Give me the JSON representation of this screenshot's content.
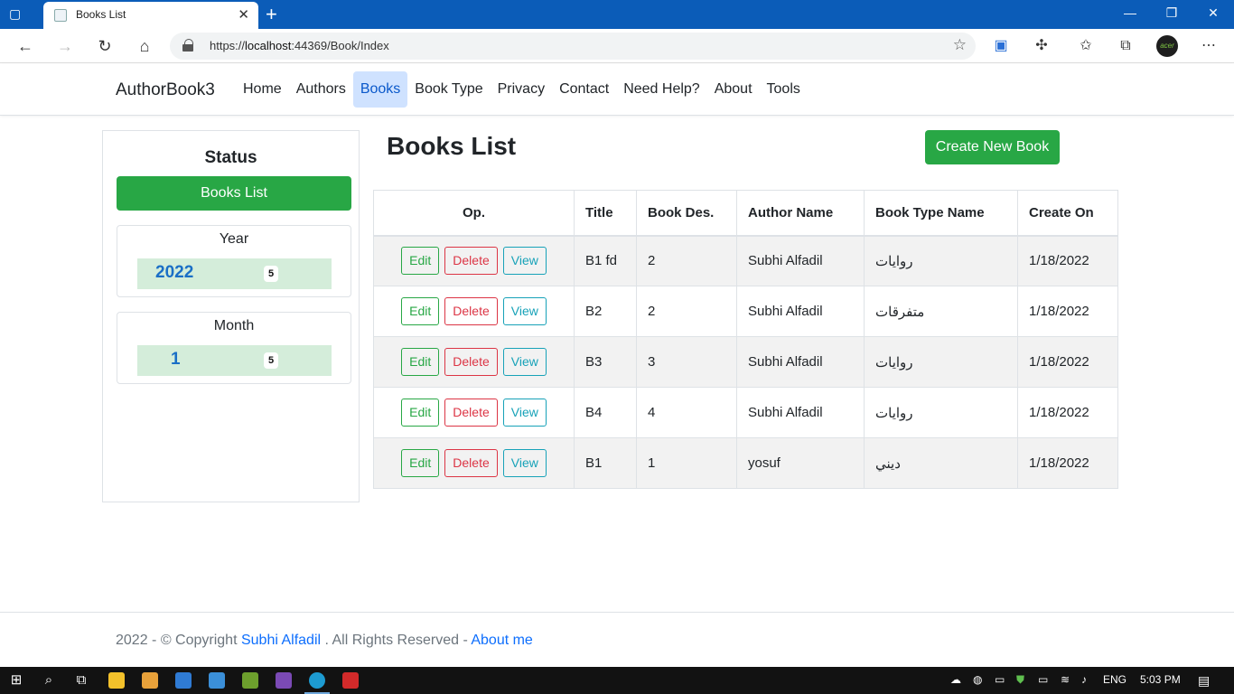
{
  "browser": {
    "tab_title": "Books List",
    "url_prefix": "https://",
    "url_host": "localhost",
    "url_path": ":44369/Book/Index",
    "profile_label": "acer"
  },
  "navbar": {
    "brand": "AuthorBook3",
    "links": [
      "Home",
      "Authors",
      "Books",
      "Book Type",
      "Privacy",
      "Contact",
      "Need Help?",
      "About",
      "Tools"
    ],
    "active": "Books"
  },
  "sidebar": {
    "title": "Status",
    "button": "Books List",
    "year_card": {
      "title": "Year",
      "value": "2022",
      "count": "5"
    },
    "month_card": {
      "title": "Month",
      "value": "1",
      "count": "5"
    }
  },
  "main": {
    "title": "Books List",
    "create_button": "Create New Book",
    "headers": [
      "Op.",
      "Title",
      "Book Des.",
      "Author Name",
      "Book Type Name",
      "Create On"
    ],
    "op_labels": {
      "edit": "Edit",
      "delete": "Delete",
      "view": "View"
    },
    "rows": [
      {
        "title": "B1 fd",
        "desc": "2",
        "author": "Subhi Alfadil",
        "type": "روايات",
        "created": "1/18/2022"
      },
      {
        "title": "B2",
        "desc": "2",
        "author": "Subhi Alfadil",
        "type": "متفرقات",
        "created": "1/18/2022"
      },
      {
        "title": "B3",
        "desc": "3",
        "author": "Subhi Alfadil",
        "type": "روايات",
        "created": "1/18/2022"
      },
      {
        "title": "B4",
        "desc": "4",
        "author": "Subhi Alfadil",
        "type": "روايات",
        "created": "1/18/2022"
      },
      {
        "title": "B1",
        "desc": "1",
        "author": "yosuf",
        "type": "ديني",
        "created": "1/18/2022"
      }
    ]
  },
  "footer": {
    "prefix": "2022 - © Copyright",
    "author_link": "Subhi Alfadil",
    "middle": ". All Rights Reserved -",
    "about_link": "About me"
  },
  "taskbar": {
    "language": "ENG",
    "time": "5:03 PM"
  }
}
